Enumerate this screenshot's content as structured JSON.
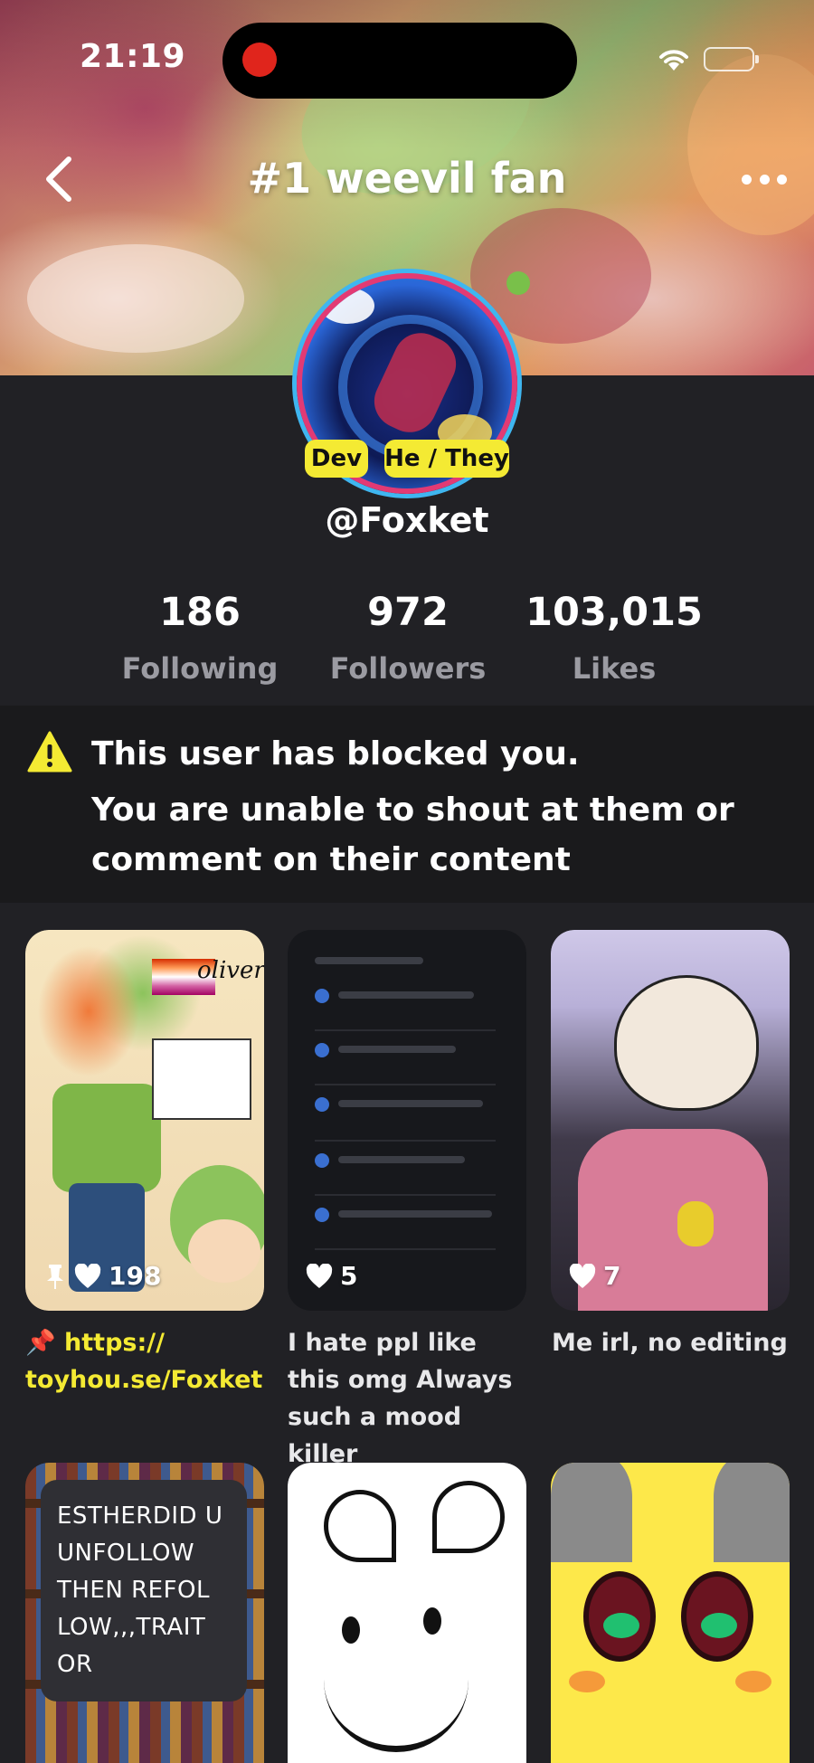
{
  "status_bar": {
    "time": "21:19"
  },
  "header": {
    "title": "#1 weevil fan"
  },
  "profile": {
    "badges": [
      "Dev",
      "He / They"
    ],
    "username": "@Foxket",
    "stats": [
      {
        "value": "186",
        "label": "Following"
      },
      {
        "value": "972",
        "label": "Followers"
      },
      {
        "value": "103,015",
        "label": "Likes"
      }
    ]
  },
  "notice": {
    "icon": "warning-icon",
    "title": "This user has blocked you.",
    "body": "You are unable to shout at them or comment on their content"
  },
  "posts": [
    {
      "likes": "198",
      "pinned": true,
      "caption_pin": "📌",
      "caption": "https:// toyhou.se/Foxket",
      "thumb_name": "oliver"
    },
    {
      "likes": "5",
      "pinned": false,
      "caption": "I hate ppl like this omg Always such a mood killer"
    },
    {
      "likes": "7",
      "pinned": false,
      "caption": "Me irl, no editing"
    },
    {
      "likes": "",
      "caption": "",
      "overlay_text": "ESTHERDID U UNFOLLOW THEN REFOL LOW,,,TRAIT OR"
    },
    {
      "likes": "",
      "caption": ""
    },
    {
      "likes": "",
      "caption": ""
    }
  ],
  "colors": {
    "background": "#212125",
    "notice_background": "#1a1a1c",
    "badge": "#f4ea33",
    "link": "#f4ea33",
    "secondary_text": "#9b9ba2",
    "recording_dot": "#e0251c"
  }
}
